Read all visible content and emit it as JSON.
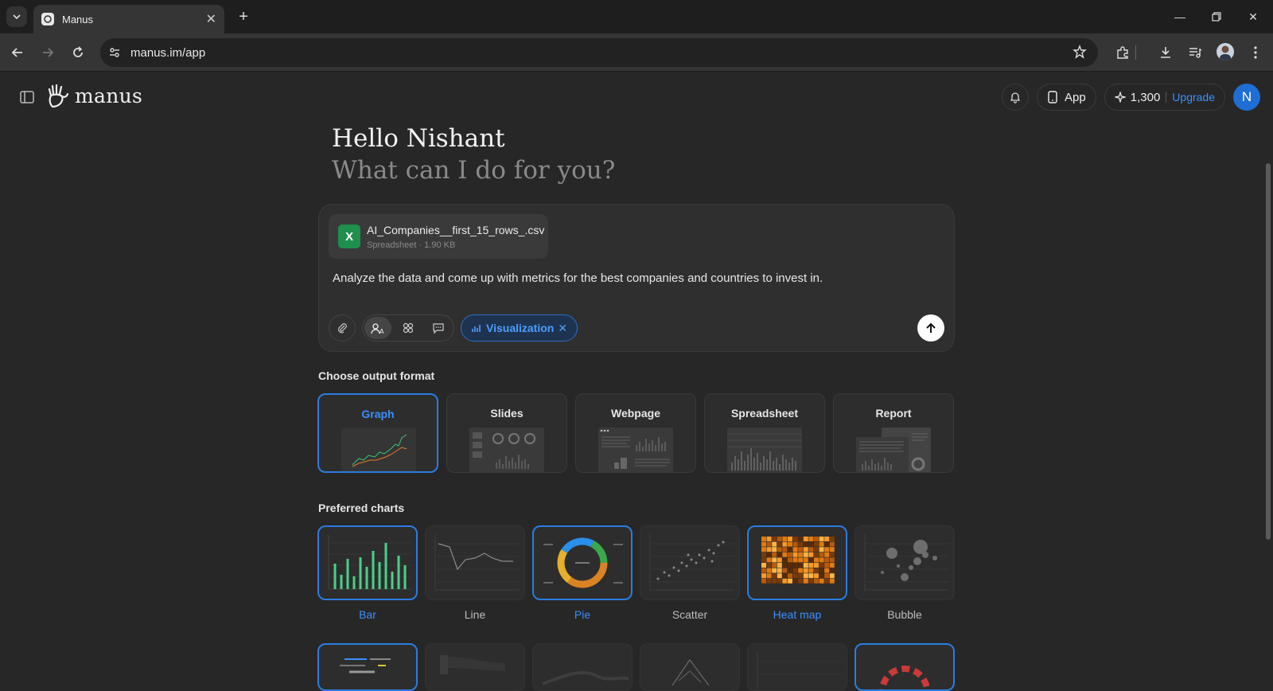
{
  "browser": {
    "tab_title": "Manus",
    "url": "manus.im/app"
  },
  "header": {
    "logo_text": "manus",
    "app_label": "App",
    "credits": "1,300",
    "upgrade_label": "Upgrade",
    "avatar_initial": "N"
  },
  "greeting": {
    "title": "Hello Nishant",
    "subtitle": "What can I do for you?"
  },
  "composer": {
    "file_name": "AI_Companies__first_15_rows_.csv",
    "file_meta": "Spreadsheet · 1.90 KB",
    "file_icon_letter": "X",
    "prompt": "Analyze the data and come up with metrics for the best companies and countries to invest in.",
    "tag_label": "Visualization"
  },
  "output_format": {
    "title": "Choose output format",
    "options": [
      "Graph",
      "Slides",
      "Webpage",
      "Spreadsheet",
      "Report"
    ],
    "selected": "Graph"
  },
  "preferred_charts": {
    "title": "Preferred charts",
    "options": [
      "Bar",
      "Line",
      "Pie",
      "Scatter",
      "Heat map",
      "Bubble"
    ],
    "selected": [
      "Bar",
      "Pie",
      "Heat map"
    ]
  },
  "colors": {
    "accent": "#3a8fff",
    "background": "#272727",
    "selected_border": "#2b7ce0"
  }
}
